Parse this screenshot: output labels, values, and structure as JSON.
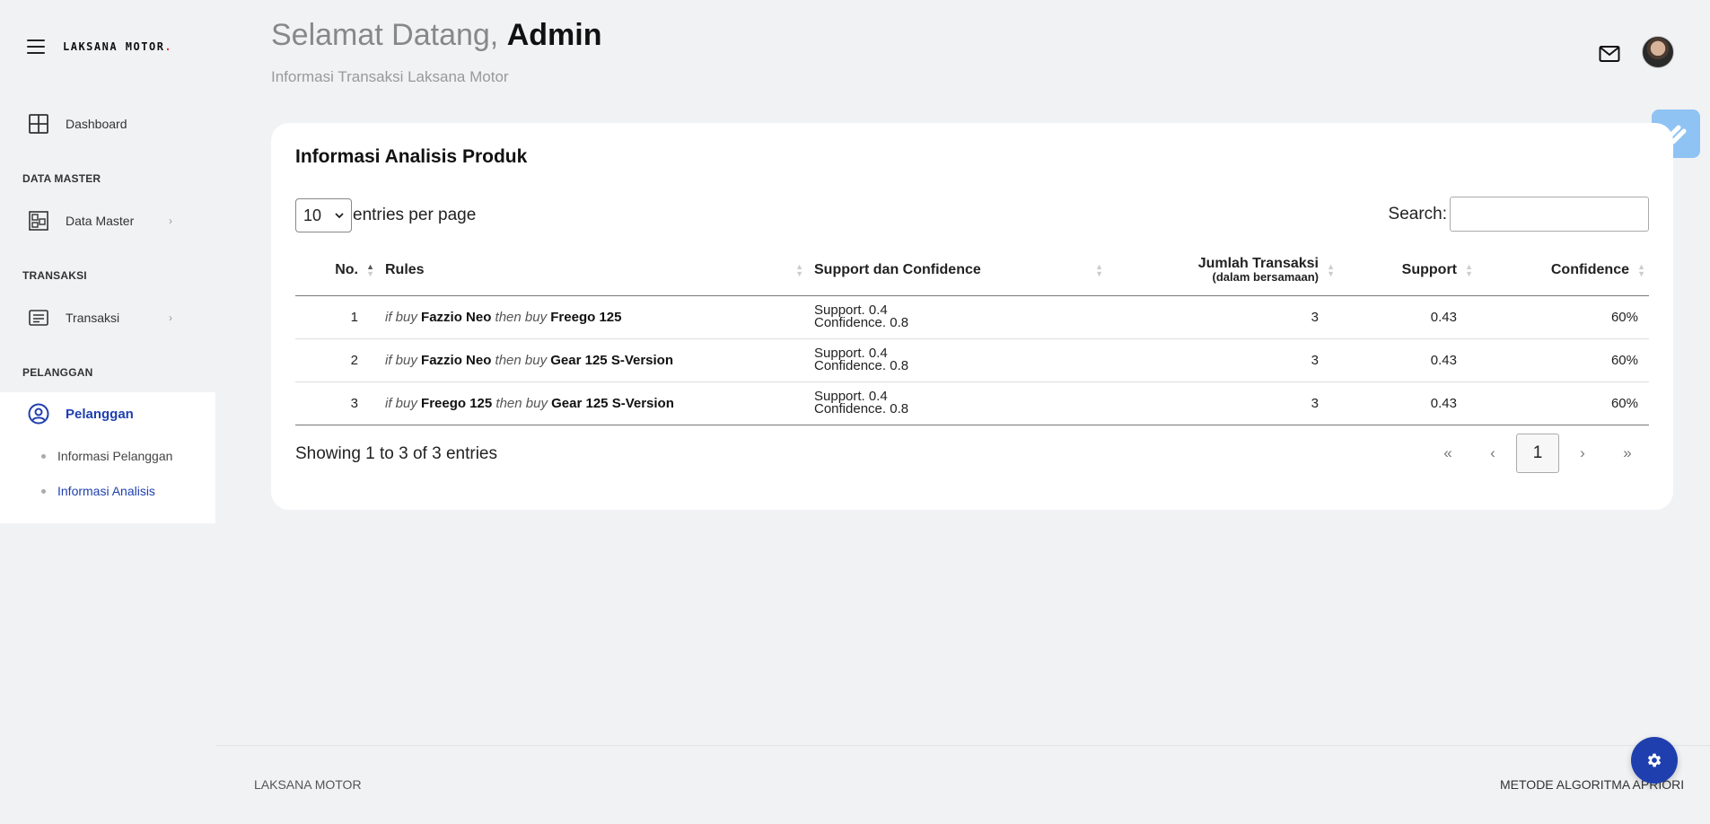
{
  "sidebar": {
    "brand": "LAKSANA MOTOR",
    "brand_dot": ".",
    "dashboard_label": "Dashboard",
    "section_data_master": "DATA MASTER",
    "data_master_label": "Data Master",
    "section_transaksi": "TRANSAKSI",
    "transaksi_label": "Transaksi",
    "section_pelanggan": "PELANGGAN",
    "pelanggan_label": "Pelanggan",
    "sub_items": [
      "Informasi Pelanggan",
      "Informasi Analisis"
    ],
    "chevron": "›"
  },
  "header": {
    "greeting": "Selamat Datang,",
    "user": "Admin",
    "subtitle": "Informasi Transaksi Laksana Motor"
  },
  "card": {
    "title": "Informasi Analisis Produk",
    "entries_value": "10",
    "entries_label": "entries per page",
    "search_label": "Search:",
    "search_value": "",
    "columns": {
      "no": "No.",
      "rules": "Rules",
      "support_confidence": "Support dan Confidence",
      "jumlah": "Jumlah Transaksi",
      "jumlah_sub": "(dalam bersamaan)",
      "support": "Support",
      "confidence": "Confidence"
    },
    "rule_words": {
      "if_buy": "if buy",
      "then_buy": "then buy"
    },
    "rows": [
      {
        "no": "1",
        "antecedent": "Fazzio Neo",
        "consequent": "Freego 125",
        "support_line": "Support. 0.4",
        "confidence_line": "Confidence. 0.8",
        "jumlah": "3",
        "support": "0.43",
        "confidence": "60%"
      },
      {
        "no": "2",
        "antecedent": "Fazzio Neo",
        "consequent": "Gear 125 S-Version",
        "support_line": "Support. 0.4",
        "confidence_line": "Confidence. 0.8",
        "jumlah": "3",
        "support": "0.43",
        "confidence": "60%"
      },
      {
        "no": "3",
        "antecedent": "Freego 125",
        "consequent": "Gear 125 S-Version",
        "support_line": "Support. 0.4",
        "confidence_line": "Confidence. 0.8",
        "jumlah": "3",
        "support": "0.43",
        "confidence": "60%"
      }
    ],
    "showing": "Showing 1 to 3 of 3 entries",
    "pager": {
      "first": "«",
      "prev": "‹",
      "current": "1",
      "next": "›",
      "last": "»"
    }
  },
  "footer": {
    "left": "LAKSANA MOTOR",
    "right": "METODE ALGORITMA APRIORI"
  },
  "colors": {
    "accent": "#1f3fae",
    "brand_dot": "#e2362b",
    "background": "#f1f2f4",
    "badge": "#8fc3f4"
  }
}
